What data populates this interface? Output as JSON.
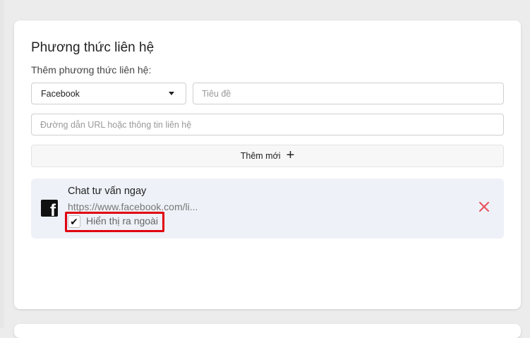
{
  "section": {
    "title": "Phương thức liên hệ",
    "add_label": "Thêm phương thức liên hệ:"
  },
  "form": {
    "type_select_value": "Facebook",
    "title_placeholder": "Tiêu đề",
    "url_placeholder": "Đường dẫn URL hoặc thông tin liên hệ",
    "add_button_label": "Thêm mới"
  },
  "contact_item": {
    "icon": "facebook-icon",
    "title": "Chat tư vấn ngay",
    "url": "https://www.facebook.com/li...",
    "show_label": "Hiển thị ra ngoài",
    "show_checked": true
  },
  "colors": {
    "remove_icon": "#e8505b",
    "highlight_border": "#e0000f",
    "item_background": "#eef1f7"
  }
}
